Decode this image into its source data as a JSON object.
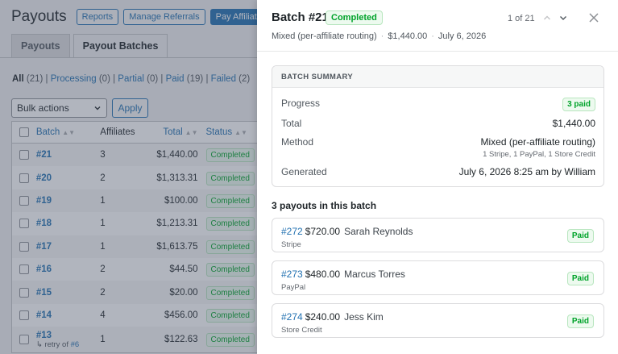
{
  "background": {
    "title": "Payouts",
    "header_buttons": [
      "Reports",
      "Manage Referrals",
      "Pay Affiliates"
    ],
    "tabs": [
      "Payouts",
      "Payout Batches"
    ],
    "active_tab": "Payout Batches",
    "filters": [
      {
        "label": "All",
        "count": "(21)"
      },
      {
        "label": "Processing",
        "count": "(0)"
      },
      {
        "label": "Partial",
        "count": "(0)"
      },
      {
        "label": "Paid",
        "count": "(19)"
      },
      {
        "label": "Failed",
        "count": "(2)"
      }
    ],
    "bulk_actions": "Bulk actions",
    "apply": "Apply",
    "columns": {
      "batch": "Batch",
      "affiliates": "Affiliates",
      "total": "Total",
      "status": "Status"
    },
    "rows": [
      {
        "batch": "#21",
        "affiliates": "3",
        "total": "$1,440.00",
        "status": "Completed"
      },
      {
        "batch": "#20",
        "affiliates": "2",
        "total": "$1,313.31",
        "status": "Completed"
      },
      {
        "batch": "#19",
        "affiliates": "1",
        "total": "$100.00",
        "status": "Completed"
      },
      {
        "batch": "#18",
        "affiliates": "1",
        "total": "$1,213.31",
        "status": "Completed"
      },
      {
        "batch": "#17",
        "affiliates": "1",
        "total": "$1,613.75",
        "status": "Completed"
      },
      {
        "batch": "#16",
        "affiliates": "2",
        "total": "$44.50",
        "status": "Completed"
      },
      {
        "batch": "#15",
        "affiliates": "2",
        "total": "$20.00",
        "status": "Completed"
      },
      {
        "batch": "#14",
        "affiliates": "4",
        "total": "$456.00",
        "status": "Completed"
      },
      {
        "batch": "#13",
        "affiliates": "1",
        "total": "$122.63",
        "status": "Completed",
        "retry_prefix": "↳ retry of",
        "retry_link": "#6"
      }
    ]
  },
  "drawer": {
    "title": "Batch #21",
    "status": "Completed",
    "subtitle": {
      "method": "Mixed (per-affiliate routing)",
      "total": "$1,440.00",
      "date": "July 6, 2026"
    },
    "pager": "1 of 21",
    "summary": {
      "heading": "BATCH SUMMARY",
      "progress_label": "Progress",
      "progress_value": "3 paid",
      "total_label": "Total",
      "total_value": "$1,440.00",
      "method_label": "Method",
      "method_value": "Mixed (per-affiliate routing)",
      "method_sub": "1 Stripe, 1 PayPal, 1 Store Credit",
      "generated_label": "Generated",
      "generated_value": "July 6, 2026 8:25 am by William"
    },
    "payouts_heading": "3 payouts in this batch",
    "payouts": [
      {
        "id": "#272",
        "amount": "$720.00",
        "name": "Sarah Reynolds",
        "method": "Stripe",
        "status": "Paid"
      },
      {
        "id": "#273",
        "amount": "$480.00",
        "name": "Marcus Torres",
        "method": "PayPal",
        "status": "Paid"
      },
      {
        "id": "#274",
        "amount": "$240.00",
        "name": "Jess Kim",
        "method": "Store Credit",
        "status": "Paid"
      }
    ]
  }
}
